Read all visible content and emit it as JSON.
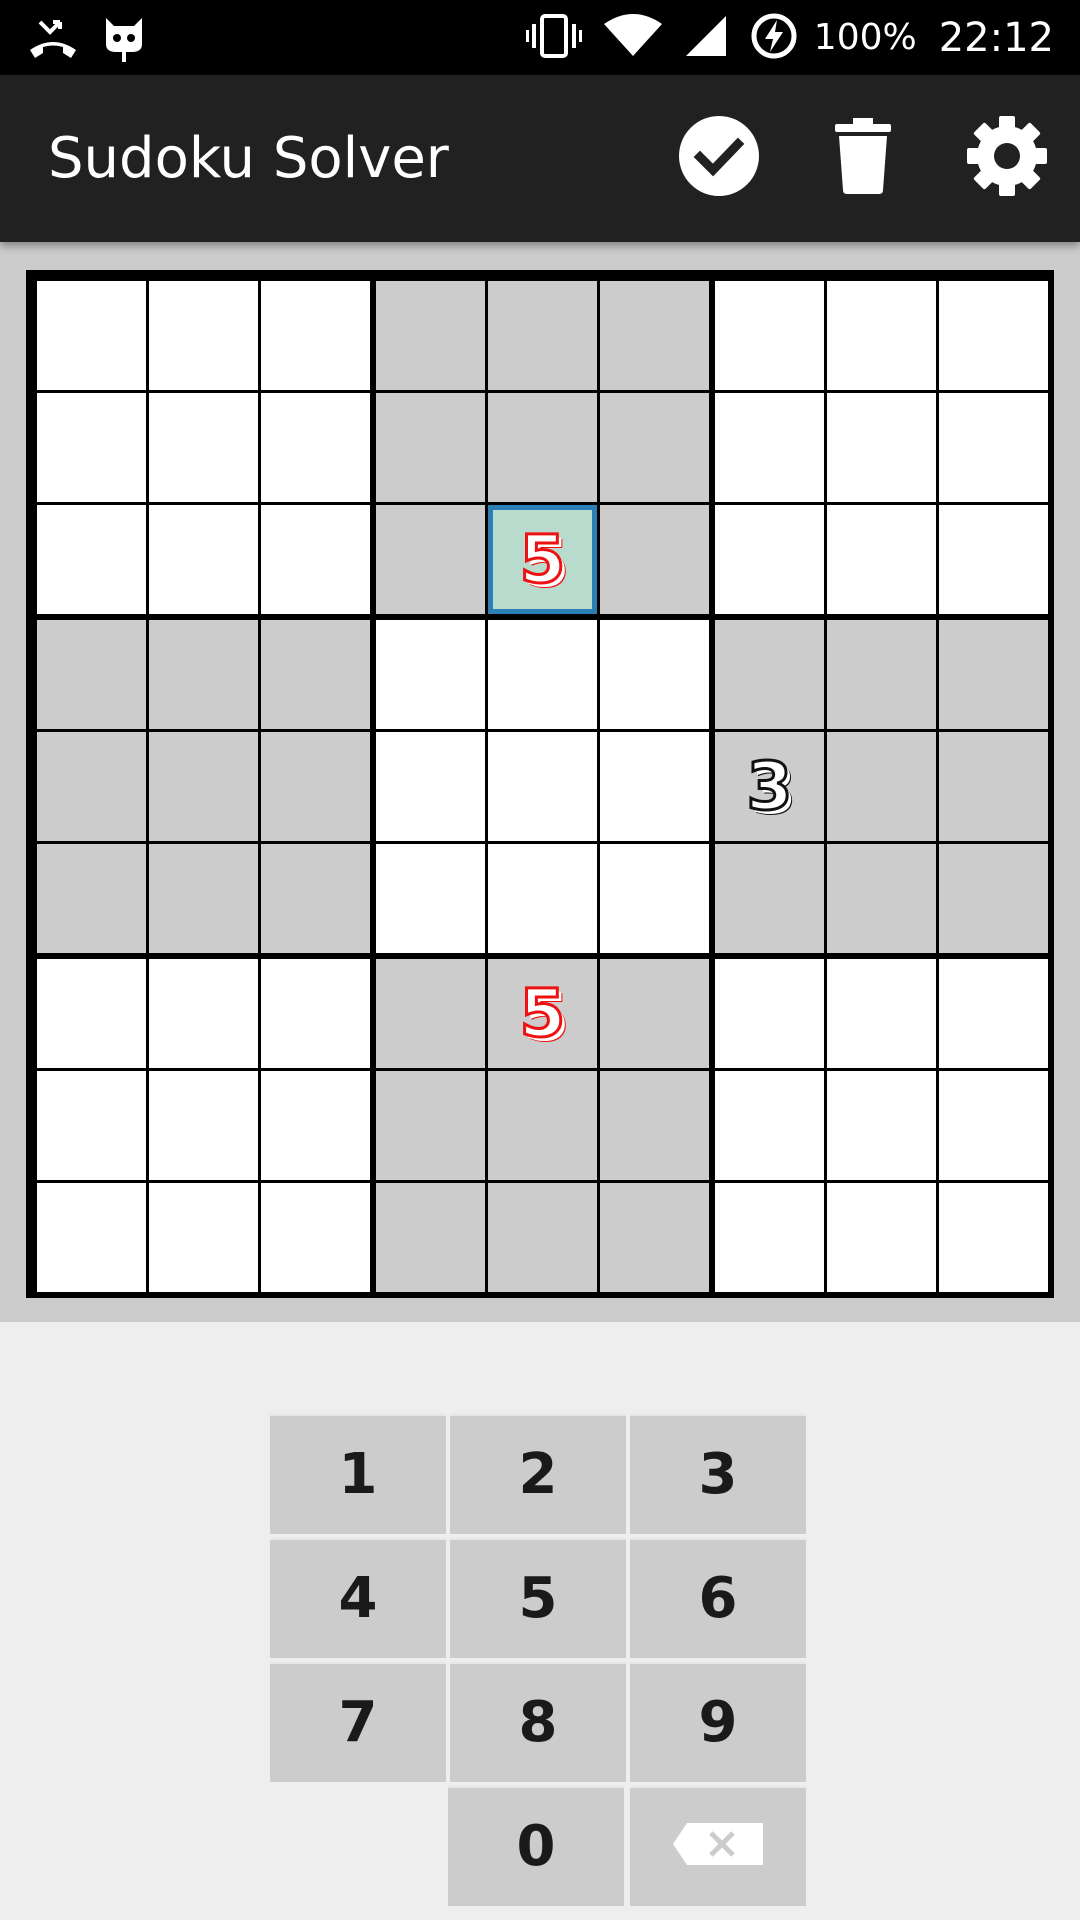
{
  "status_bar": {
    "battery_text": "100%",
    "time": "22:12",
    "icons": [
      "missed-call-icon",
      "cyanogenmod-icon",
      "vibrate-icon",
      "wifi-icon",
      "signal-icon",
      "battery-charging-icon"
    ]
  },
  "app_bar": {
    "title": "Sudoku Solver",
    "actions": [
      "check-circle-icon",
      "trash-icon",
      "gear-icon"
    ]
  },
  "board": {
    "colors": {
      "light_cell": "#ffffff",
      "shaded_cell": "#cccccc",
      "selected_fill": "#b9dbcd",
      "selected_border": "#2b7fb5",
      "red_digit": "#ee1111",
      "black_digit": "#111111"
    },
    "selected": [
      2,
      4
    ],
    "cells": [
      {
        "row": 2,
        "col": 4,
        "value": "5",
        "color": "red"
      },
      {
        "row": 4,
        "col": 6,
        "value": "3",
        "color": "black"
      },
      {
        "row": 6,
        "col": 4,
        "value": "5",
        "color": "red"
      }
    ]
  },
  "keypad": {
    "keys": [
      "1",
      "2",
      "3",
      "4",
      "5",
      "6",
      "7",
      "8",
      "9",
      "0"
    ],
    "backspace_icon": "backspace-icon"
  }
}
